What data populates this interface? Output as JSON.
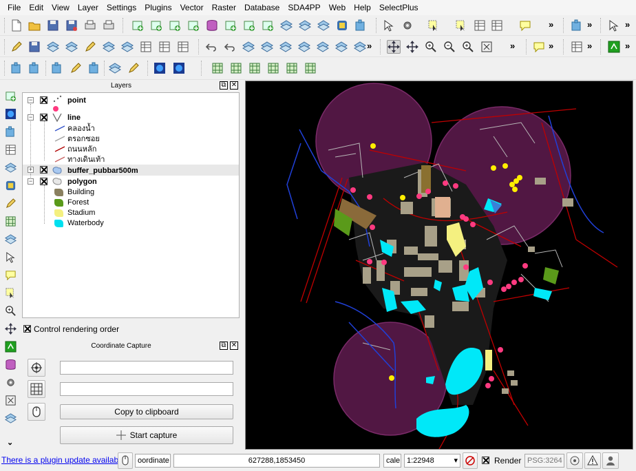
{
  "menu": [
    "File",
    "Edit",
    "View",
    "Layer",
    "Settings",
    "Plugins",
    "Vector",
    "Raster",
    "Database",
    "SDA4PP",
    "Web",
    "Help",
    "SelectPlus"
  ],
  "toolbar": {
    "overflow": "»"
  },
  "layers_panel": {
    "title": "Layers",
    "float_button": "⧉",
    "close_button": "✕",
    "tree": [
      {
        "label": "point",
        "bold": true
      },
      {
        "label": "line",
        "bold": true
      },
      {
        "label": "คลองน้ำ",
        "color": "#3050c8"
      },
      {
        "label": "ตรอกซอย",
        "color": "#a0a0a0"
      },
      {
        "label": "ถนนหลัก",
        "color": "#b00000"
      },
      {
        "label": "ทางเดินเท้า",
        "color": "#c86060"
      },
      {
        "label": "buffer_pubbar500m",
        "bold": true
      },
      {
        "label": "polygon",
        "bold": true
      },
      {
        "label": "Building",
        "color": "#8a8060"
      },
      {
        "label": "Forest",
        "color": "#5a9a1a"
      },
      {
        "label": "Stadium",
        "color": "#f4f080"
      },
      {
        "label": "Waterbody",
        "color": "#00e0f0"
      }
    ],
    "control_rendering_order": "Control rendering order"
  },
  "coordinate_capture": {
    "title": "Coordinate Capture",
    "field1": "",
    "field2": "",
    "copy_button": "Copy to clipboard",
    "start_button": "Start capture"
  },
  "statusbar": {
    "plugin_update": "There is a plugin update available",
    "coordinate_label": "oordinate",
    "coordinate_value": "627288,1853450",
    "scale_label": "cale",
    "scale_value": "1:22948",
    "render_label": "Render",
    "crs": "PSG:3264"
  },
  "colors": {
    "buffer": "#5a1a4a",
    "water": "#00e8f8",
    "building": "#a8a088",
    "road": "#c00000",
    "point_pink": "#ff3a80",
    "point_yellow": "#ffee00"
  }
}
